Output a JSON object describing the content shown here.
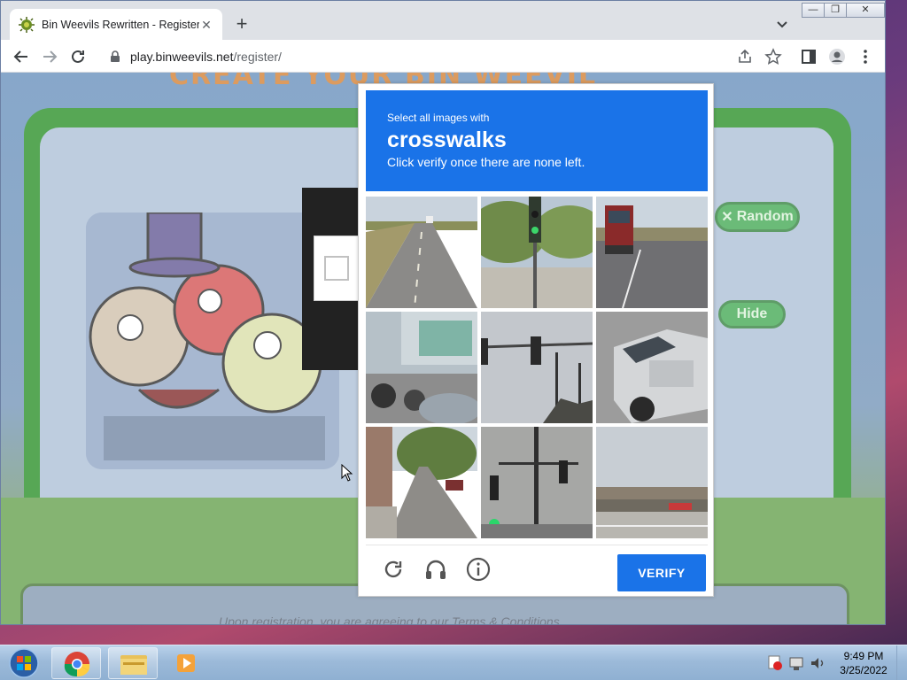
{
  "browser": {
    "tab_title": "Bin Weevils Rewritten - Register",
    "tab_close": "✕",
    "new_tab": "+",
    "window_controls": [
      "—",
      "❐",
      "✕"
    ],
    "url_host": "play.binweevils.net",
    "url_path": "/register/"
  },
  "page": {
    "headline": "CREATE YOUR BIN WEEVIL",
    "random_label": "Random",
    "hide_label": "Hide",
    "terms_text": "Upon registration, you are agreeing to our Terms & Conditions"
  },
  "captcha": {
    "instruction_small": "Select all images with",
    "instruction_target": "crosswalks",
    "instruction_sub": "Click verify once there are none left.",
    "verify_label": "VERIFY",
    "footer_icons": [
      "reload-icon",
      "audio-challenge-icon",
      "info-icon"
    ],
    "tiles": [
      "road-with-car",
      "traffic-light-trees",
      "red-truck-highway",
      "parked-motorcycles",
      "traffic-signals-sky",
      "silver-suv",
      "tree-lined-street",
      "traffic-poles",
      "overpass-red-car"
    ],
    "accent_color": "#1a73e8"
  },
  "taskbar": {
    "time": "9:49 PM",
    "date": "3/25/2022",
    "pinned": [
      "chrome-icon",
      "file-explorer-icon",
      "media-player-icon"
    ]
  }
}
